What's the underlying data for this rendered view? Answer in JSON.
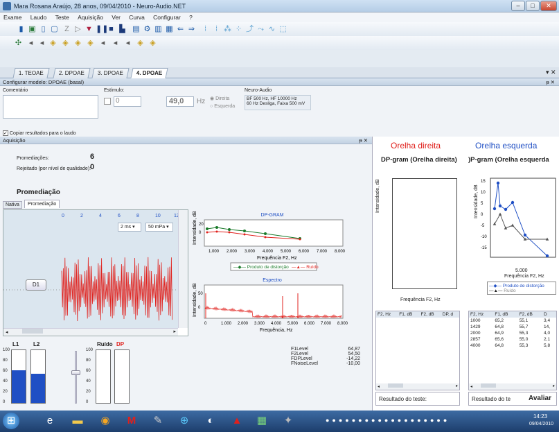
{
  "window": {
    "title": "Mara Rosana Araújo, 28 anos, 09/04/2010 - Neuro-Audio.NET"
  },
  "menu": [
    "Exame",
    "Laudo",
    "Teste",
    "Aquisição",
    "Ver",
    "Curva",
    "Configurar",
    "?"
  ],
  "tabs": [
    "1. TEOAE",
    "2. DPOAE",
    "3. DPOAE",
    "4. DPOAE"
  ],
  "config": {
    "header": "Configurar modelo: DPOAE (basal)",
    "comment_label": "Comentário",
    "stimulus_label": "Estímulo:",
    "stimulus_value": "0",
    "level_value": "49,0",
    "level_unit": "Hz",
    "ear_right": "Direita",
    "ear_left": "Esquerda",
    "device_label": "Neuro-Audio",
    "device_line1": "BF  500 Hz, HF  10000 Hz",
    "device_line2": "60 Hz  Desliga, Faixa 500 mV",
    "copy_results": "Copiar resultados para o laudo"
  },
  "acq": {
    "header": "Aquisição",
    "avg_label": "Promediações:",
    "avg_value": "6",
    "rejected_label": "Rejeitado (por nível de qualidade):",
    "rejected_value": "0",
    "section_title": "Promediação",
    "subtab_native": "Nativa",
    "subtab_avg": "Promediação",
    "scale_ticks": [
      "0",
      "2",
      "4",
      "6",
      "8",
      "10",
      "12"
    ],
    "time_select": "2 ms",
    "amp_select": "50 mPa",
    "d1_button": "D1",
    "l1": "L1",
    "l2": "L2",
    "noise": "Ruído",
    "dp": "DP",
    "bar_ticks": [
      "100",
      "80",
      "60",
      "40",
      "20",
      "0"
    ],
    "l1_level": 0.62,
    "l2_level": 0.55,
    "levels": [
      {
        "name": "F1Level",
        "value": "64,87"
      },
      {
        "name": "F2Level",
        "value": "54,50"
      },
      {
        "name": "FDPLevel",
        "value": "-14,22"
      },
      {
        "name": "FNoiseLevel",
        "value": "-10,00"
      }
    ]
  },
  "dpgram": {
    "title": "DP-GRAM",
    "ylabel": "Intensidade, dB",
    "xlabel": "Frequência F2, Hz",
    "xticks": [
      "1.000",
      "2.000",
      "3.000",
      "4.000",
      "5.000",
      "6.000",
      "7.000",
      "8.000"
    ],
    "yticks": [
      "20",
      "0"
    ],
    "legend_dp": "Produto de distorção",
    "legend_noise": "Ruído"
  },
  "spectrum": {
    "title": "Espectro",
    "ylabel": "Intensidade, dB",
    "xlabel": "Frequência, Hz",
    "xticks": [
      "0",
      "1.000",
      "2.000",
      "3.000",
      "4.000",
      "5.000",
      "6.000",
      "7.000",
      "8.000"
    ],
    "yticks": [
      "50",
      "0"
    ]
  },
  "right": {
    "title": "Orelha direita",
    "title_color": "#e0201c",
    "gram_title": "DP-gram (Orelha direita)",
    "ylabel": "Intensidade, dB",
    "xlabel": "Frequência F2, Hz",
    "cols": [
      "F2, Hz",
      "F1, dB",
      "F2, dB",
      "DP, d"
    ],
    "result": "Resultado do teste:"
  },
  "left": {
    "title": "Orelha esquerda",
    "title_color": "#1f4fc4",
    "gram_title": ")P-gram (Orelha esquerda",
    "ylabel": "Intensidade, dB",
    "xlabel": "Frequência F2, Hz",
    "xtick": "5.000",
    "yticks": [
      "15",
      "10",
      "5",
      "0",
      "-5",
      "-10",
      "-15"
    ],
    "legend_dp": "Produto de distorção",
    "legend_noise": "Ruído",
    "cols": [
      "F2, Hz",
      "F1, dB",
      "F2, dB",
      "D"
    ],
    "rows": [
      [
        "1000",
        "65,2",
        "55,1",
        "3,4"
      ],
      [
        "1429",
        "64,8",
        "55,7",
        "14,"
      ],
      [
        "2000",
        "64,9",
        "55,3",
        "4,0"
      ],
      [
        "2857",
        "65,6",
        "55,0",
        "2,1"
      ],
      [
        "4000",
        "64,8",
        "55,3",
        "5,8"
      ]
    ],
    "result": "Resultado do te",
    "evaluate_button": "Avaliar"
  },
  "taskbar": {
    "time": "14:23",
    "date": "09/04/2010"
  }
}
